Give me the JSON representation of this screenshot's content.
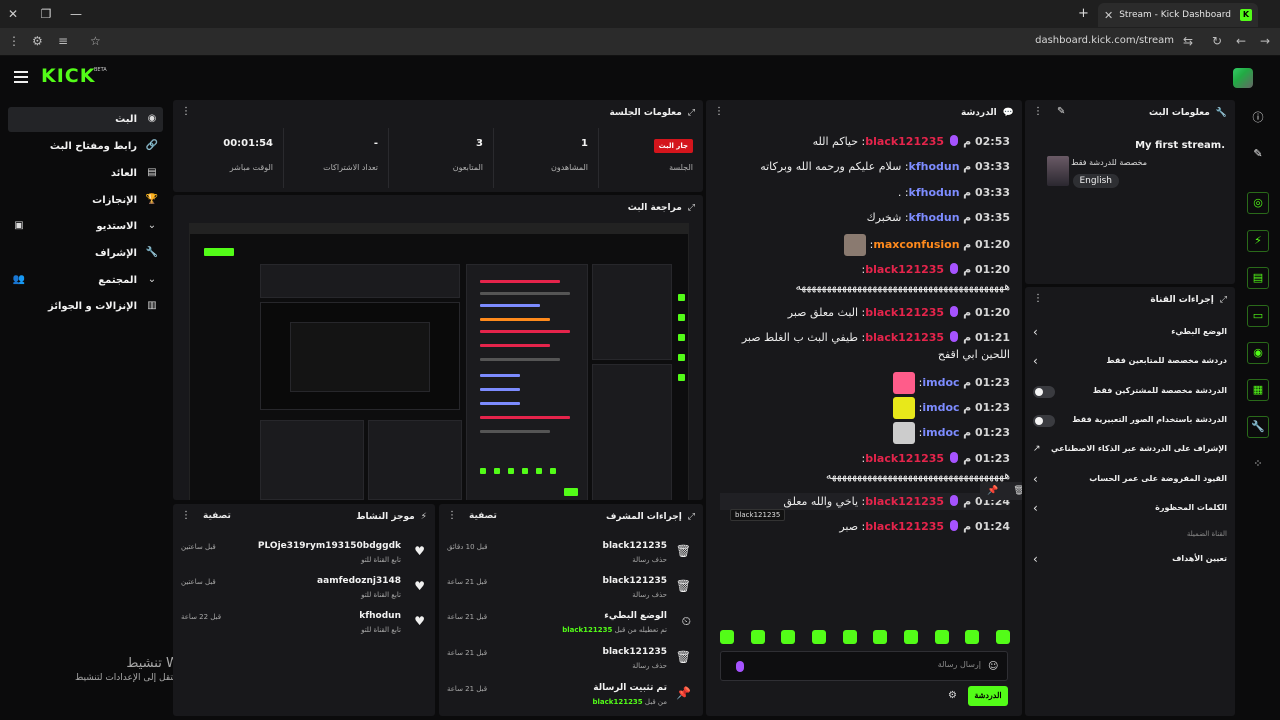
{
  "browser": {
    "tab_title": "Stream - Kick Dashboard",
    "tab_favicon": "K",
    "url": "dashboard.kick.com/stream"
  },
  "app": {
    "logo": "KICK",
    "beta": "BETA",
    "accent": "#53fc18"
  },
  "sidebar": {
    "items": [
      {
        "label": "البث",
        "icon": "broadcast-icon",
        "active": true
      },
      {
        "label": "رابط ومفتاح البث",
        "icon": "link-icon"
      },
      {
        "label": "العائد",
        "icon": "revenue-icon"
      },
      {
        "label": "الإنجازات",
        "icon": "trophy-icon"
      },
      {
        "label": "الاستديو",
        "icon": "studio-icon"
      },
      {
        "label": "الإشراف",
        "icon": "wrench-icon"
      },
      {
        "label": "المجتمع",
        "icon": "community-icon"
      },
      {
        "label": "الإنزالات و الجوائز",
        "icon": "drops-icon"
      }
    ]
  },
  "windows_watermark": {
    "line1": "تنشيط Windows",
    "line2": "انتقل إلى الإعدادات لتنشيط Windows."
  },
  "session": {
    "title": "معلومات الجلسة",
    "stats": [
      {
        "value": "جار البث",
        "label": "الجلسة",
        "badge": true
      },
      {
        "value": "1",
        "label": "المشاهدون"
      },
      {
        "value": "3",
        "label": "المتابعون"
      },
      {
        "value": "-",
        "label": "تعداد الاشتراكات"
      },
      {
        "value": "00:01:54",
        "label": "الوقت مباشر"
      }
    ]
  },
  "preview": {
    "title": "مراجعة البث"
  },
  "activity": {
    "title": "موجز النشاط",
    "filter": "تصفية",
    "items": [
      {
        "name": "PLOje319rym193150bdggdk",
        "sub": "تابع القناة للتو",
        "time": "قبل ساعتين",
        "icon": "heart-icon"
      },
      {
        "name": "aamfedoznj3148",
        "sub": "تابع القناة للتو",
        "time": "قبل ساعتين",
        "icon": "heart-icon"
      },
      {
        "name": "kfhodun",
        "sub": "تابع القناة للتو",
        "time": "قبل 22 ساعة",
        "icon": "heart-icon"
      }
    ]
  },
  "mod_actions": {
    "title": "إجراءات المشرف",
    "filter": "تصفية",
    "items": [
      {
        "name": "black121235",
        "sub": "حذف رسالة",
        "time": "قبل 10 دقائق",
        "icon": "trash-icon"
      },
      {
        "name": "black121235",
        "sub": "حذف رسالة",
        "time": "قبل 21 ساعة",
        "icon": "trash-icon"
      },
      {
        "name": "الوضع البطيء",
        "sub": "تم تعطيله من قبل",
        "subuser": "black121235",
        "time": "قبل 21 ساعة",
        "icon": "slow-mode-icon"
      },
      {
        "name": "black121235",
        "sub": "حذف رسالة",
        "time": "قبل 21 ساعة",
        "icon": "trash-icon"
      },
      {
        "name": "تم تثبيت الرسالة",
        "sub": "من قبل",
        "subuser": "black121235",
        "time": "قبل 21 ساعة",
        "icon": "pin-icon"
      }
    ]
  },
  "chat": {
    "title": "الدردشة",
    "messages": [
      {
        "time": "02:53 م",
        "user": "black121235",
        "color": "red",
        "mic": true,
        "text": "حياكم الله"
      },
      {
        "time": "03:33 م",
        "user": "kfhodun",
        "color": "blue",
        "text": "سلام عليكم ورحمه الله وبركاته"
      },
      {
        "time": "03:33 م",
        "user": "kfhodun",
        "color": "blue",
        "text": "."
      },
      {
        "time": "03:35 م",
        "user": "kfhodun",
        "color": "blue",
        "text": "شخبرك"
      },
      {
        "time": "01:20 م",
        "user": "maxconfusion",
        "color": "orange",
        "text": "",
        "emote": "#8a7a70"
      },
      {
        "time": "01:20 م",
        "user": "black121235",
        "color": "red",
        "mic": true,
        "text": "هههههههههههههههههههههههههههههههههههههههههه"
      },
      {
        "time": "01:20 م",
        "user": "black121235",
        "color": "red",
        "mic": true,
        "text": "البث معلق صبر"
      },
      {
        "time": "01:21 م",
        "user": "black121235",
        "color": "red",
        "mic": true,
        "text": "طيفي البث ب الغلط صبر اللحين ابي اقفح"
      },
      {
        "time": "01:23 م",
        "user": "imdoc",
        "color": "blue",
        "text": "",
        "emote": "#ff5c8a"
      },
      {
        "time": "01:23 م",
        "user": "imdoc",
        "color": "blue",
        "text": "",
        "emote": "#e8e81a"
      },
      {
        "time": "01:23 م",
        "user": "imdoc",
        "color": "blue",
        "text": "",
        "emote": "#cccccc"
      },
      {
        "time": "01:23 م",
        "user": "black121235",
        "color": "red",
        "mic": true,
        "text": "هههههههههههههههههههههههههههههههههههه"
      },
      {
        "time": "01:24 م",
        "user": "black121235",
        "color": "red",
        "mic": true,
        "text": "ياخي والله معلق"
      },
      {
        "time": "01:24 م",
        "user": "black121235",
        "color": "red",
        "mic": true,
        "text": "صبر"
      }
    ],
    "tooltip": "black121235",
    "input_placeholder": "إرسال رسالة",
    "send_label": "الدردشة"
  },
  "stream_info": {
    "title": "معلومات البث",
    "stream_title": "My first stream.",
    "category": "مخصصة للدردشة فقط",
    "language": "English"
  },
  "channel_actions": {
    "title": "إجراءات القناة",
    "rows": [
      {
        "label": "الوضع البطيء",
        "control": "chevron"
      },
      {
        "label": "دردشة مخصصة للمتابعين فقط",
        "control": "chevron"
      },
      {
        "label": "الدردشة مخصصة للمشتركين فقط",
        "control": "toggle"
      },
      {
        "label": "الدردشة باستخدام الصور التعبيرية فقط",
        "control": "toggle"
      },
      {
        "label": "الإشراف على الدردشة عبر الذكاء الاصطناعي",
        "control": "external"
      },
      {
        "label": "القيود المفروضة على عمر الحساب",
        "control": "chevron"
      },
      {
        "label": "الكلمات المحظورة",
        "control": "chevron"
      }
    ],
    "hint": "القناة الضميلة",
    "goals": "تعيين الأهداف"
  },
  "rail": [
    "info-icon",
    "pencil-icon",
    "target-icon",
    "lightning-icon",
    "document-icon",
    "chat-bubble-icon",
    "broadcast-signal-icon",
    "layout-icon",
    "wrench-icon",
    "dots-cluster-icon"
  ]
}
